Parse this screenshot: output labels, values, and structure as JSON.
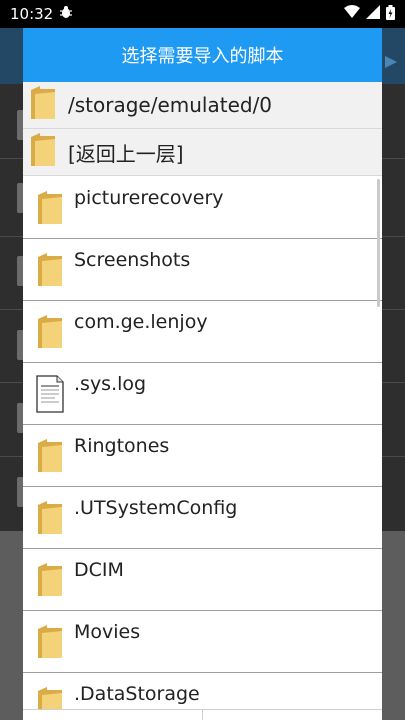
{
  "status_bar": {
    "time": "10:32",
    "notification_icon": "bug-icon",
    "icons": [
      "wifi-icon",
      "signal-icon",
      "battery-icon"
    ]
  },
  "dialog": {
    "title": "选择需要导入的脚本",
    "current_path": "/storage/emulated/0",
    "parent_label": "[返回上一层]",
    "items": [
      {
        "name": "picturerecovery",
        "type": "folder"
      },
      {
        "name": "Screenshots",
        "type": "folder"
      },
      {
        "name": "com.ge.lenjoy",
        "type": "folder"
      },
      {
        "name": ".sys.log",
        "type": "file"
      },
      {
        "name": "Ringtones",
        "type": "folder"
      },
      {
        "name": ".UTSystemConfig",
        "type": "folder"
      },
      {
        "name": "DCIM",
        "type": "folder"
      },
      {
        "name": "Movies",
        "type": "folder"
      },
      {
        "name": ".DataStorage",
        "type": "folder"
      }
    ]
  },
  "colors": {
    "header": "#1e9af3",
    "folder": "#f4d27a",
    "folder_dark": "#d9ac45"
  }
}
